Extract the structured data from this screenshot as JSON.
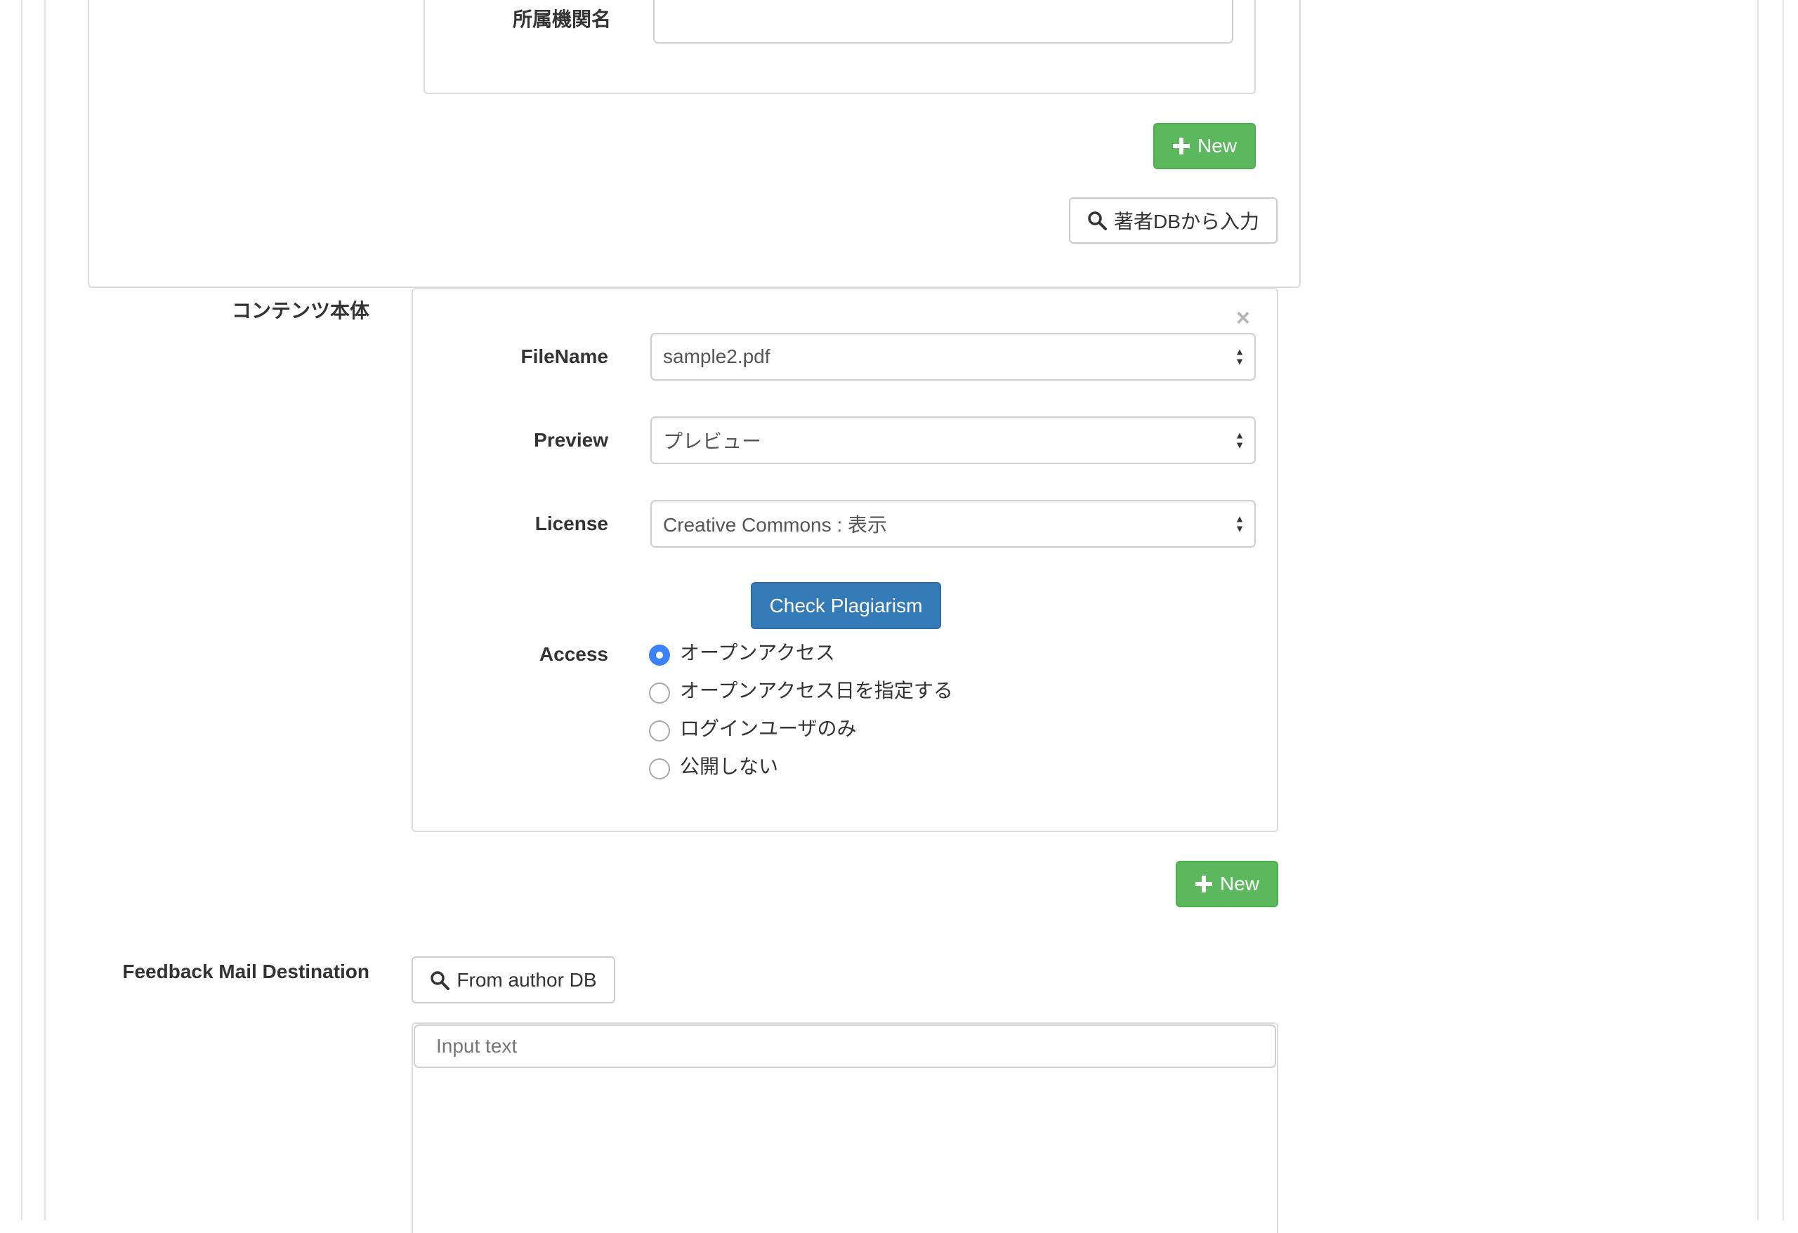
{
  "affiliation": {
    "label": "所属機関名",
    "value": ""
  },
  "author_section": {
    "new_button": "New",
    "author_db_button": "著者DBから入力"
  },
  "content": {
    "label": "コンテンツ本体",
    "close_glyph": "×",
    "filename": {
      "label": "FileName",
      "value": "sample2.pdf"
    },
    "preview": {
      "label": "Preview",
      "value": "プレビュー"
    },
    "license": {
      "label": "License",
      "value": "Creative Commons : 表示"
    },
    "check_plagiarism_button": "Check Plagiarism",
    "access": {
      "label": "Access",
      "options": [
        {
          "label": "オープンアクセス",
          "checked": true
        },
        {
          "label": "オープンアクセス日を指定する",
          "checked": false
        },
        {
          "label": "ログインユーザのみ",
          "checked": false
        },
        {
          "label": "公開しない",
          "checked": false
        }
      ]
    },
    "new_button": "New"
  },
  "feedback": {
    "label": "Feedback Mail Destination",
    "from_author_db_button": "From author DB",
    "input_placeholder": "Input text"
  },
  "colors": {
    "green": "#5cb85c",
    "blue": "#337ab7",
    "radio_checked": "#3b82f6",
    "border": "#dcdcdc"
  },
  "icons": {
    "plus": "plus-icon",
    "search": "search-icon",
    "close": "close-icon"
  }
}
